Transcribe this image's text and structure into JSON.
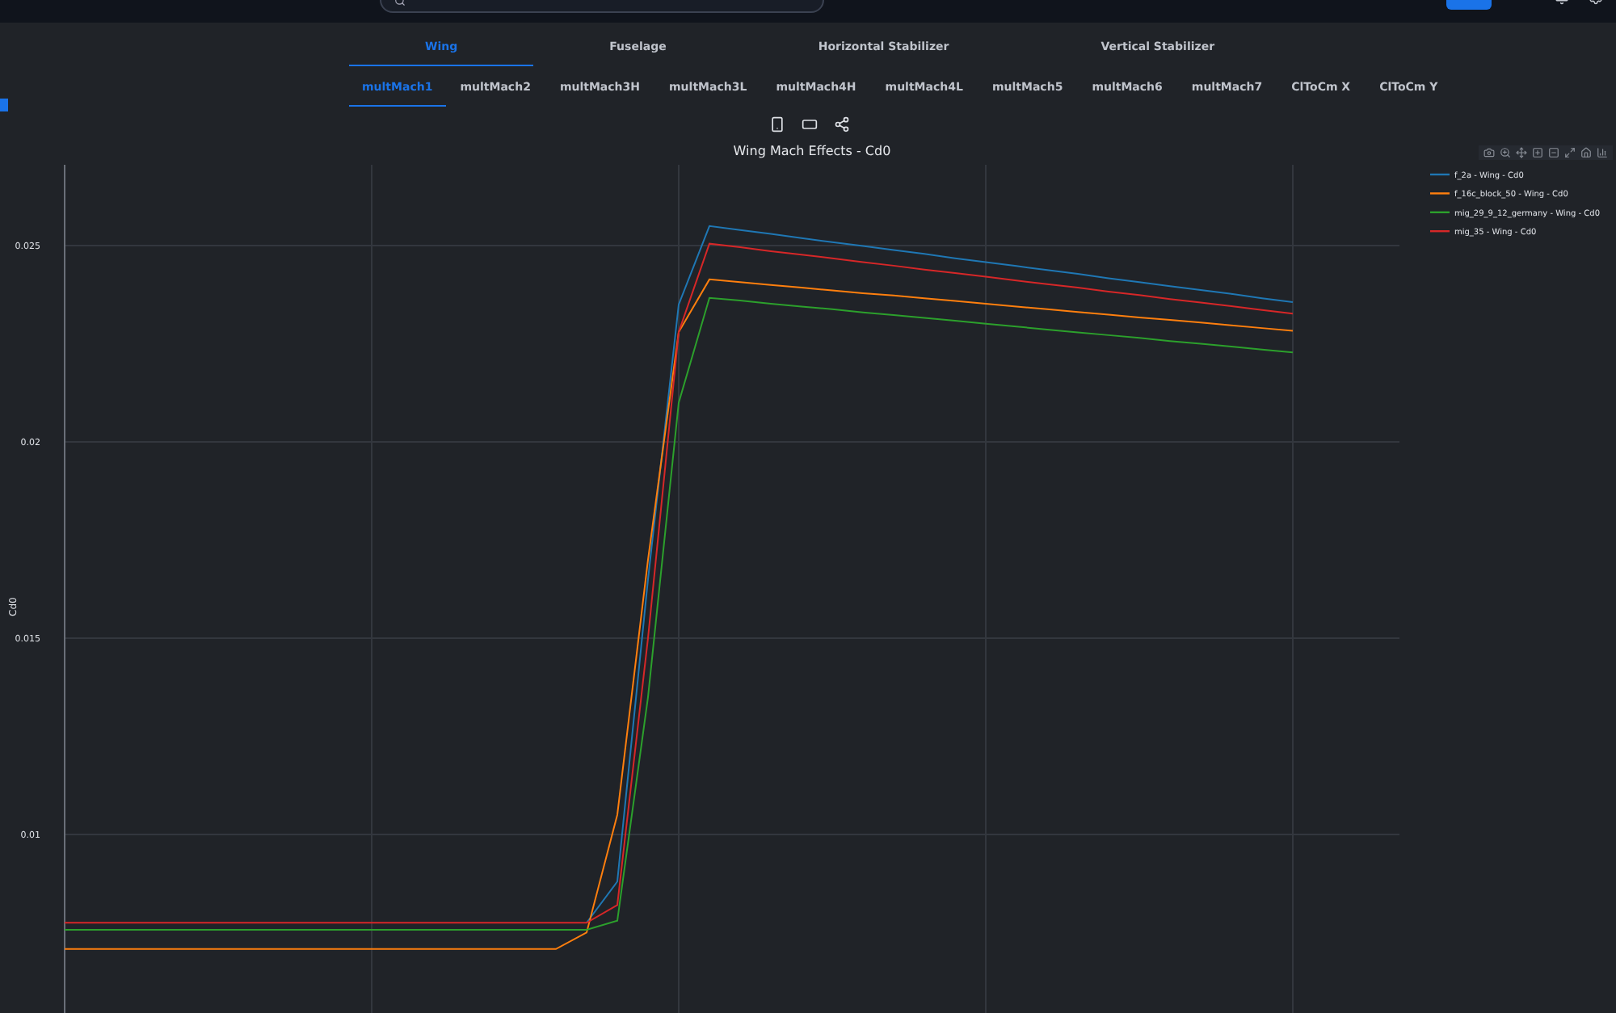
{
  "tabs": [
    {
      "label": "Wing",
      "selected": true
    },
    {
      "label": "Fuselage",
      "selected": false
    },
    {
      "label": "Horizontal Stabilizer",
      "selected": false
    },
    {
      "label": "Vertical Stabilizer",
      "selected": false
    }
  ],
  "subtabs": [
    {
      "label": "multMach1",
      "selected": true
    },
    {
      "label": "multMach2",
      "selected": false
    },
    {
      "label": "multMach3H",
      "selected": false
    },
    {
      "label": "multMach3L",
      "selected": false
    },
    {
      "label": "multMach4H",
      "selected": false
    },
    {
      "label": "multMach4L",
      "selected": false
    },
    {
      "label": "multMach5",
      "selected": false
    },
    {
      "label": "multMach6",
      "selected": false
    },
    {
      "label": "multMach7",
      "selected": false
    },
    {
      "label": "ClToCm X",
      "selected": false
    },
    {
      "label": "ClToCm Y",
      "selected": false
    }
  ],
  "chart": {
    "chart_data": {
      "type": "line",
      "title": "Wing Mach Effects - Cd0",
      "ylabel": "Cd0",
      "categories": [
        null,
        null,
        null,
        null,
        null,
        null,
        null,
        null,
        null,
        null,
        null,
        null,
        null,
        null,
        null,
        null,
        null,
        null,
        null,
        null,
        null,
        null,
        null,
        null,
        null,
        null,
        null,
        null,
        null,
        null,
        null,
        null,
        null,
        null,
        null,
        null,
        null,
        null,
        null,
        null,
        null
      ],
      "ylim": [
        0.00545,
        0.02706
      ],
      "grid": true,
      "legend": true,
      "yticks": [
        0.01,
        0.015,
        0.02,
        0.025
      ],
      "series": [
        {
          "name": "f_2a - Wing - Cd0",
          "color": "#1f77b4",
          "values": [
            null,
            null,
            null,
            null,
            null,
            null,
            null,
            null,
            null,
            null,
            null,
            null,
            null,
            null,
            null,
            null,
            null,
            0.00775,
            0.0088,
            0.0165,
            0.0235,
            0.0255,
            0.0254,
            0.0253,
            0.02519,
            0.02509,
            0.02499,
            0.02489,
            0.02479,
            0.02468,
            0.02458,
            0.02448,
            0.02438,
            0.02428,
            0.02417,
            0.02407,
            0.02397,
            0.02387,
            0.02377,
            0.02366,
            0.02356
          ]
        },
        {
          "name": "f_16c_block_50 - Wing - Cd0",
          "color": "#ff7f0e",
          "values": [
            0.00708,
            0.00708,
            0.00708,
            0.00708,
            0.00708,
            0.00708,
            0.00708,
            0.00708,
            0.00708,
            0.00708,
            0.00708,
            0.00708,
            0.00708,
            0.00708,
            0.00708,
            0.00708,
            0.00708,
            0.0075,
            0.0105,
            0.017,
            0.0228,
            0.02414,
            0.02407,
            0.024,
            0.02393,
            0.02386,
            0.02379,
            0.02373,
            0.02366,
            0.02359,
            0.02352,
            0.02345,
            0.02338,
            0.02331,
            0.02324,
            0.02317,
            0.02311,
            0.02304,
            0.02297,
            0.0229,
            0.02283
          ]
        },
        {
          "name": "mig_29_9_12_germany - Wing - Cd0",
          "color": "#2ca02c",
          "values": [
            0.00757,
            0.00757,
            0.00757,
            0.00757,
            0.00757,
            0.00757,
            0.00757,
            0.00757,
            0.00757,
            0.00757,
            0.00757,
            0.00757,
            0.00757,
            0.00757,
            0.00757,
            0.00757,
            0.00757,
            0.00757,
            0.0078,
            0.0135,
            0.021,
            0.02367,
            0.0236,
            0.02352,
            0.02345,
            0.02338,
            0.0233,
            0.02323,
            0.02316,
            0.02309,
            0.02301,
            0.02294,
            0.02286,
            0.02279,
            0.02272,
            0.02265,
            0.02257,
            0.0225,
            0.02243,
            0.02235,
            0.02228
          ]
        },
        {
          "name": "mig_35 - Wing - Cd0",
          "color": "#d62728",
          "values": [
            0.00775,
            0.00775,
            0.00775,
            0.00775,
            0.00775,
            0.00775,
            0.00775,
            0.00775,
            0.00775,
            0.00775,
            0.00775,
            0.00775,
            0.00775,
            0.00775,
            0.00775,
            0.00775,
            0.00775,
            0.00775,
            0.0082,
            0.015,
            0.0228,
            0.02505,
            0.02496,
            0.02486,
            0.02477,
            0.02468,
            0.02458,
            0.02449,
            0.02439,
            0.0243,
            0.02421,
            0.02411,
            0.02402,
            0.02393,
            0.02383,
            0.02374,
            0.02364,
            0.02355,
            0.02346,
            0.02336,
            0.02327
          ]
        }
      ]
    }
  }
}
